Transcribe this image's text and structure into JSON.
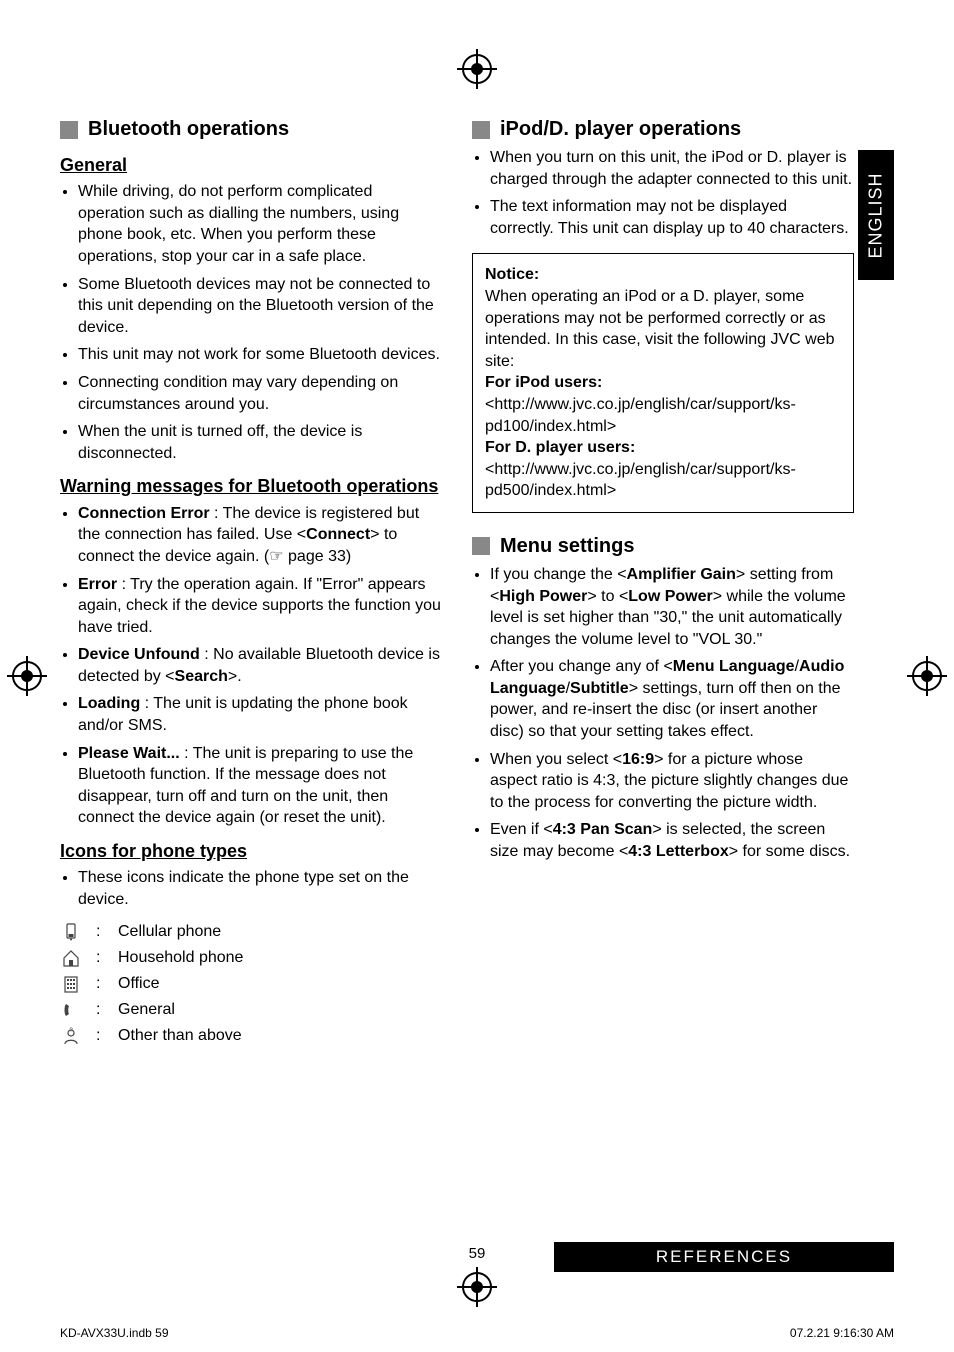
{
  "lang_tab": "ENGLISH",
  "left": {
    "sec1_title": "Bluetooth operations",
    "sub_general": "General",
    "general_items": [
      "While driving, do not perform complicated operation such as dialling the numbers, using phone book, etc. When you perform these operations, stop your car in a safe place.",
      "Some Bluetooth devices may not be connected to this unit depending on the Bluetooth version of the device.",
      "This unit may not work for some Bluetooth devices.",
      "Connecting condition may vary depending on circumstances around you.",
      "When the unit is turned off, the device is disconnected."
    ],
    "sub_warn": "Warning messages for Bluetooth operations",
    "warn_items": {
      "ce_label": "Connection Error",
      "ce_text": " : The device is registered but the connection has failed. Use <",
      "ce_bold": "Connect",
      "ce_text2": "> to connect the device again. (☞ page 33)",
      "err_label": "Error",
      "err_text": " : Try the operation again. If \"Error\" appears again, check if the device supports the function you have tried.",
      "du_label": "Device Unfound",
      "du_text": " : No available Bluetooth device is detected by <",
      "du_bold": "Search",
      "du_text2": ">.",
      "ld_label": "Loading",
      "ld_text": " : The unit is updating the phone book and/or SMS.",
      "pw_label": "Please Wait...",
      "pw_text": " : The unit is preparing to use the Bluetooth function. If the message does not disappear, turn off and turn on the unit, then connect the device again (or reset the unit)."
    },
    "sub_icons": "Icons for phone types",
    "icons_intro": "These icons indicate the phone type set on the device.",
    "icon_labels": {
      "cell": "Cellular phone",
      "house": "Household phone",
      "office": "Office",
      "general": "General",
      "other": "Other than above"
    }
  },
  "right": {
    "sec1_title": "iPod/D. player operations",
    "ipod_items": [
      "When you turn on this unit, the iPod or D. player is charged through the adapter connected to this unit.",
      "The text information may not be displayed correctly. This unit can display up to 40 characters."
    ],
    "notice_title": "Notice:",
    "notice_p1": "When operating an iPod or a D. player, some operations may not be performed correctly or as intended. In this case, visit the following JVC web site:",
    "notice_ipod_label": "For iPod users:",
    "notice_ipod_url": " <http://www.jvc.co.jp/english/car/support/ks-pd100/index.html>",
    "notice_dp_label": "For D. player users:",
    "notice_dp_url": " <http://www.jvc.co.jp/english/car/support/ks-pd500/index.html>",
    "sec2_title": "Menu settings",
    "menu_items": {
      "m1_a": "If you change the <",
      "m1_b": "Amplifier Gain",
      "m1_c": "> setting from <",
      "m1_d": "High Power",
      "m1_e": "> to <",
      "m1_f": "Low Power",
      "m1_g": "> while the volume level is set higher than \"30,\" the unit automatically changes the volume level to \"VOL 30.\"",
      "m2_a": "After you change any of <",
      "m2_b": "Menu Language",
      "m2_slash": "/",
      "m2_c": "Audio Language",
      "m2_d": "Subtitle",
      "m2_e": "> settings, turn off then on the power, and re-insert the disc (or insert another disc) so that your setting takes effect.",
      "m3_a": "When you select <",
      "m3_b": "16:9",
      "m3_c": "> for a picture whose aspect ratio is 4:3, the picture slightly changes due to the process for converting the picture width.",
      "m4_a": "Even if <",
      "m4_b": "4:3 Pan Scan",
      "m4_c": "> is selected, the screen size may become <",
      "m4_d": "4:3 Letterbox",
      "m4_e": "> for some discs."
    }
  },
  "page_number": "59",
  "footer_bar": "REFERENCES",
  "print_left": "KD-AVX33U.indb   59",
  "print_right": "07.2.21   9:16:30 AM"
}
